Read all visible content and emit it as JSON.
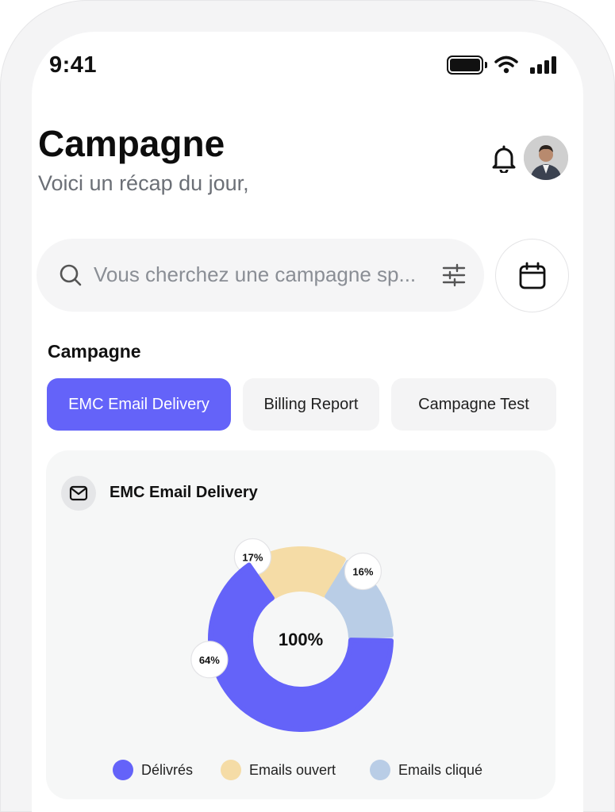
{
  "status_bar": {
    "time": "9:41"
  },
  "header": {
    "title": "Campagne",
    "subtitle": "Voici un récap du jour,"
  },
  "search": {
    "placeholder": "Vous cherchez une campagne sp..."
  },
  "section": {
    "title": "Campagne"
  },
  "tabs": [
    {
      "label": "EMC Email Delivery",
      "active": true
    },
    {
      "label": "Billing Report",
      "active": false
    },
    {
      "label": "Campagne Test",
      "active": false
    }
  ],
  "card": {
    "title": "EMC Email Delivery"
  },
  "colors": {
    "accent": "#6463f9",
    "opened": "#f5dca6",
    "clicked": "#b9cde6"
  },
  "chart_data": {
    "type": "pie",
    "center_label": "100%",
    "series": [
      {
        "name": "Délivrés",
        "value": 64,
        "label": "64%",
        "color": "#6463f9"
      },
      {
        "name": "Emails ouvert",
        "value": 17,
        "label": "17%",
        "color": "#f5dca6"
      },
      {
        "name": "Emails cliqué",
        "value": 16,
        "label": "16%",
        "color": "#b9cde6"
      }
    ]
  }
}
